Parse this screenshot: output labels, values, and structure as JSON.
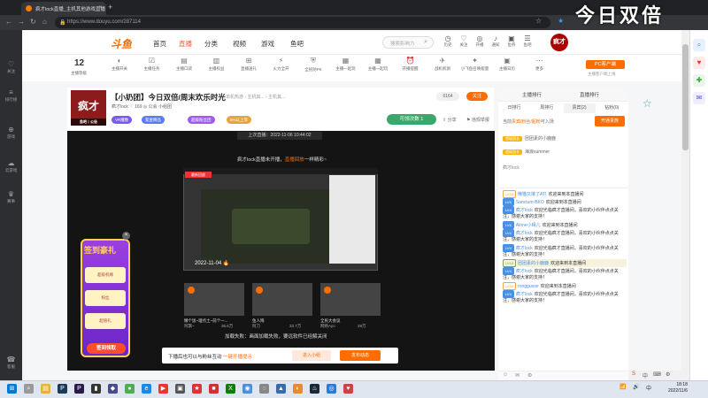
{
  "browser": {
    "tab_title": "疯才lock直播_主机其他游戏直播",
    "url": "https://www.douyu.com/287114",
    "watermark": "今日双倍"
  },
  "left_sidebar": {
    "items": [
      {
        "label": "关注",
        "icon": "heart-icon"
      },
      {
        "label": "排行榜",
        "icon": "list-icon"
      },
      {
        "label": "游戏",
        "icon": "gamepad-icon"
      },
      {
        "label": "云游戏",
        "icon": "cloud-game-icon"
      },
      {
        "label": "赛事",
        "icon": "trophy-icon"
      },
      {
        "label": "客服",
        "icon": "headset-icon"
      }
    ]
  },
  "header": {
    "logo": "斗鱼",
    "nav": [
      "首页",
      "直播",
      "分类",
      "视频",
      "游戏",
      "鱼吧"
    ],
    "search_placeholder": "搜索影响力",
    "icons": [
      {
        "label": "历史",
        "icon": "history-icon"
      },
      {
        "label": "关注",
        "icon": "follow-icon"
      },
      {
        "label": "开播",
        "icon": "broadcast-icon"
      },
      {
        "label": "通知",
        "icon": "bell-icon"
      },
      {
        "label": "鱼券",
        "icon": "fish-ticket-icon"
      },
      {
        "label": "鱼吧",
        "icon": "fishbar-icon"
      }
    ],
    "avatar_text": "疯才"
  },
  "toolbar": {
    "level": "12",
    "level_label": "主播等级",
    "tools": [
      "主播开关",
      "主播任务",
      "主播口袋",
      "主播权益",
      "直播送礼",
      "火力全开",
      "全民防PK",
      "主播一起玩",
      "主播一起玩",
      "开播提醒",
      "战机机俱",
      "小飞鱼召唤能量",
      "主播日历",
      "更多"
    ],
    "pc_client": "PC客户端",
    "pc_sub": "主播客户端上线"
  },
  "streamer": {
    "title": "【小奶团】今日双倍/周末欢乐时光",
    "category": "单机热游 › 主机其... › 主机其...",
    "meta": "疯才lock  ♡ 169  ◎ 公会  小组团",
    "badges": [
      "VR魔数",
      "氪金精品",
      "超级粉丝团",
      "5%以上等"
    ],
    "avatar_text": "疯才",
    "avatar_sub": "鱼吧丨公告",
    "follow_count": "6164",
    "follow_label": "关注",
    "gift_label": "可领次数",
    "gift_count": "1",
    "share_label": "分享",
    "report_label": "违规举报"
  },
  "player": {
    "last_live": "上次直播：2022-11-06 10:44:02",
    "offline_prefix": "疯才lock直播未开播，",
    "offline_highlight": "直播回放",
    "offline_suffix": "一样精彩~",
    "preview_badge": "最新回放",
    "preview_date": "2022-11-04 🔥",
    "recommend": [
      {
        "title": "懒个饭~理点土~前个一...",
        "author": "阿飘~",
        "count": "35.6万"
      },
      {
        "title": "鱼人殇",
        "author": "阿刀",
        "count": "33.7万"
      },
      {
        "title": "全民大会议",
        "author": "网络Ayo",
        "count": "29万"
      }
    ],
    "load_fail": "加载失败：画面加载失败，要远软件已经解关闭"
  },
  "bottom_bar": {
    "text": "下播后也可以与粉丝互动",
    "link": "一键开播提示",
    "btn1": "进入小组",
    "btn2": "发布动态"
  },
  "sign_ad": {
    "title": "签到豪礼",
    "items": [
      "超级机缘",
      "粉丝",
      "超值礼"
    ],
    "button": "签到领取"
  },
  "right_panel": {
    "tabs_top": [
      "主播排行",
      "直播排行",
      "贵宾排行"
    ],
    "tabs": [
      "日排行",
      "周排行",
      "贵宾(2)",
      "钻粉(0)"
    ],
    "info_prefix": "当前",
    "info_link": "贵宾/粉丝/超粉",
    "info_suffix": "可入场",
    "open_guard": "开通贵族",
    "guard_rows": [
      {
        "badge": "超级团长",
        "name": "团团素的小鹿鹿"
      },
      {
        "badge": "超级团长",
        "name": "海浪summer"
      }
    ],
    "guard_name": "疯才lock",
    "chat": [
      {
        "lvl": "LV10",
        "style": "",
        "nick": "懒猫又接了ATI",
        "text": "欢迎来到本直播间"
      },
      {
        "lvl": "LV5",
        "style": "blue",
        "nick": "Sanctum-BKO",
        "text": "欢迎来到本直播间"
      },
      {
        "lvl": "LV4",
        "style": "blue",
        "nick": "疯才lock",
        "text": "欢迎光临疯才直播间，喜欢的小伙伴点点关注，感谢大家的支持！"
      },
      {
        "lvl": "LV6",
        "style": "blue",
        "nick": "Alone小晴儿",
        "text": "欢迎来到本直播间"
      },
      {
        "lvl": "LV4",
        "style": "blue",
        "nick": "疯才lock",
        "text": "欢迎光临疯才直播间，喜欢的小伙伴点点关注，感谢大家的支持！"
      },
      {
        "lvl": "LV4",
        "style": "blue",
        "nick": "疯才lock",
        "text": "欢迎光临疯才直播间，喜欢的小伙伴点点关注，感谢大家的支持！"
      },
      {
        "lvl": "LV16",
        "style": "green",
        "nick": "团团素的小鹿鹿",
        "text": "欢迎来到本直播间"
      },
      {
        "lvl": "LV4",
        "style": "blue",
        "nick": "疯才lock",
        "text": "欢迎光临疯才直播间，喜欢的小伙伴点点关注，感谢大家的支持！"
      },
      {
        "lvl": "LV16",
        "style": "",
        "nick": "rongguose",
        "text": "欢迎来到本直播间"
      },
      {
        "lvl": "LV4",
        "style": "blue",
        "nick": "疯才lock",
        "text": "欢迎光临疯才直播间，喜欢的小伙伴点点关注，感谢大家的支持！"
      }
    ]
  },
  "taskbar": {
    "time": "18:18",
    "date": "2022/11/6"
  },
  "colors": {
    "accent": "#ff6c00",
    "chrome_dark": "#202124",
    "player_bg": "#141414"
  }
}
